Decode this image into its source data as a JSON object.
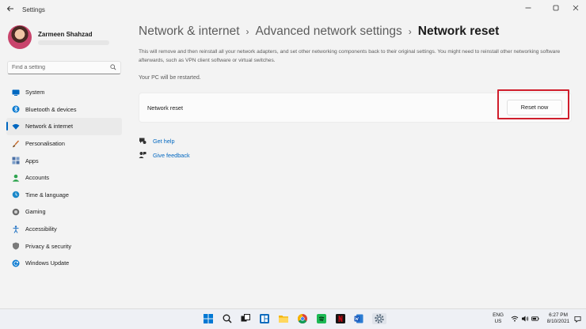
{
  "window": {
    "title": "Settings",
    "back_icon": "back-arrow-icon"
  },
  "profile": {
    "name": "Zarmeen Shahzad"
  },
  "search": {
    "placeholder": "Find a setting"
  },
  "sidebar": {
    "items": [
      {
        "label": "System",
        "icon": "monitor-icon",
        "color": "#0067c0"
      },
      {
        "label": "Bluetooth & devices",
        "icon": "bluetooth-icon",
        "color": "#0a7ad1"
      },
      {
        "label": "Network & internet",
        "icon": "wifi-icon",
        "color": "#0067c0",
        "active": true
      },
      {
        "label": "Personalisation",
        "icon": "brush-icon",
        "color": "#c86a2b"
      },
      {
        "label": "Apps",
        "icon": "apps-icon",
        "color": "#4a6fa5"
      },
      {
        "label": "Accounts",
        "icon": "person-icon",
        "color": "#2ea44f"
      },
      {
        "label": "Time & language",
        "icon": "globe-clock-icon",
        "color": "#1b88c9"
      },
      {
        "label": "Gaming",
        "icon": "gamepad-icon",
        "color": "#6b6b6b"
      },
      {
        "label": "Accessibility",
        "icon": "accessibility-icon",
        "color": "#1b6fc2"
      },
      {
        "label": "Privacy & security",
        "icon": "shield-icon",
        "color": "#7a7a7a"
      },
      {
        "label": "Windows Update",
        "icon": "update-icon",
        "color": "#0a7ad1"
      }
    ]
  },
  "breadcrumb": {
    "items": [
      "Network & internet",
      "Advanced network settings"
    ],
    "current": "Network reset",
    "separator": "›"
  },
  "main": {
    "description": "This will remove and then reinstall all your network adapters, and set other networking components back to their original settings. You might need to reinstall other networking software afterwards, such as VPN client software or virtual switches.",
    "restart_note": "Your PC will be restarted.",
    "reset_card": {
      "label": "Network reset",
      "button": "Reset now"
    },
    "links": [
      {
        "label": "Get help",
        "icon": "help-chat-icon"
      },
      {
        "label": "Give feedback",
        "icon": "feedback-icon"
      }
    ]
  },
  "taskbar": {
    "apps": [
      "start-icon",
      "search-icon",
      "task-view-icon",
      "widgets-icon",
      "file-explorer-icon",
      "chrome-icon",
      "spotify-icon",
      "netflix-icon",
      "word-icon",
      "settings-icon"
    ],
    "language_line1": "ENG",
    "language_line2": "US",
    "time": "6:27 PM",
    "date": "8/10/2021"
  },
  "colors": {
    "accent": "#0067c0",
    "highlight": "#d01e2c",
    "background": "#f3f3f3"
  }
}
